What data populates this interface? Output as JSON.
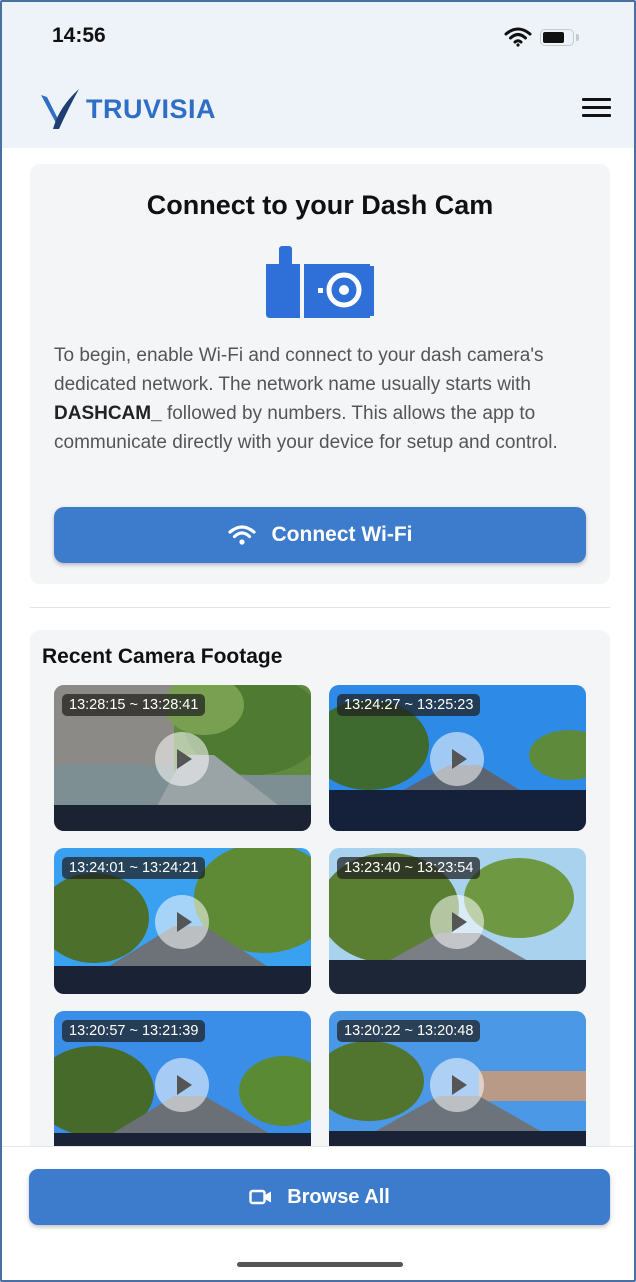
{
  "status_bar": {
    "time": "14:56"
  },
  "header": {
    "brand": "TRUVISIA"
  },
  "connect": {
    "title": "Connect to your Dash Cam",
    "desc_before": "To begin, enable Wi-Fi and connect to your dash camera's dedicated network. The network name usually starts with ",
    "desc_bold": "DASHCAM_",
    "desc_after": " followed by numbers. This allows the app to communicate directly with your device for setup and control.",
    "button_label": "Connect Wi-Fi"
  },
  "footage": {
    "title": "Recent Camera Footage",
    "clips": [
      {
        "time": "13:28:15 ~ 13:28:41"
      },
      {
        "time": "13:24:27 ~ 13:25:23"
      },
      {
        "time": "13:24:01 ~ 13:24:21"
      },
      {
        "time": "13:23:40 ~ 13:23:54"
      },
      {
        "time": "13:20:57 ~ 13:21:39"
      },
      {
        "time": "13:20:22 ~ 13:20:48"
      }
    ]
  },
  "bottom": {
    "browse_label": "Browse All"
  },
  "colors": {
    "accent": "#3d7ccc",
    "brand": "#2f6ec4",
    "header_bg": "#eef3fa",
    "card_bg": "#f4f5f7"
  }
}
